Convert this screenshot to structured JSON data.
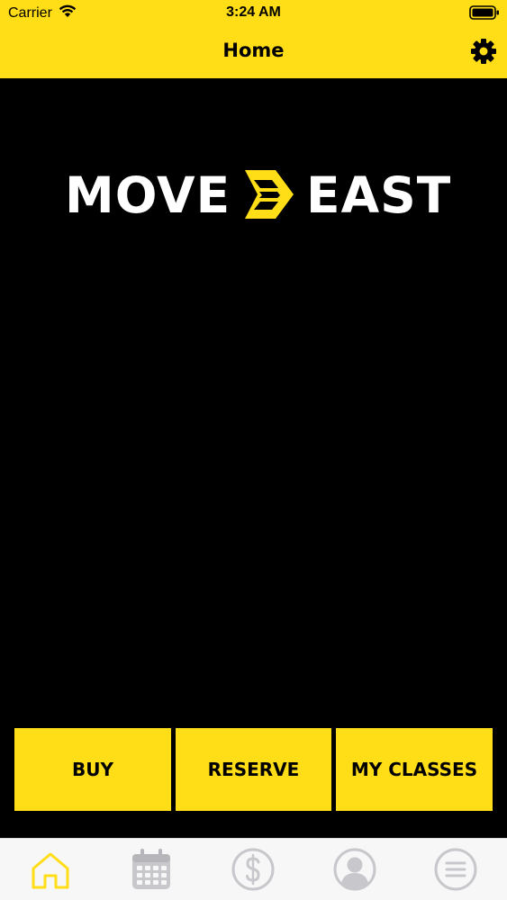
{
  "status_bar": {
    "carrier": "Carrier",
    "time": "3:24 AM",
    "wifi_icon": "wifi-icon",
    "battery_icon": "battery-icon"
  },
  "nav": {
    "title": "Home",
    "settings_icon": "gear-icon"
  },
  "logo": {
    "word_left": "MOVE",
    "word_right": "EAST",
    "mark_icon": "chevron-arrows-icon",
    "accent_color": "#FFDD17"
  },
  "actions": {
    "buy_label": "BUY",
    "reserve_label": "RESERVE",
    "my_classes_label": "MY CLASSES"
  },
  "tabs": [
    {
      "icon": "home-icon",
      "active": true
    },
    {
      "icon": "calendar-icon",
      "active": false
    },
    {
      "icon": "dollar-icon",
      "active": false
    },
    {
      "icon": "user-icon",
      "active": false
    },
    {
      "icon": "menu-icon",
      "active": false
    }
  ],
  "colors": {
    "accent": "#FFDD17",
    "background": "#000000",
    "tab_inactive": "#C7C7CC"
  }
}
